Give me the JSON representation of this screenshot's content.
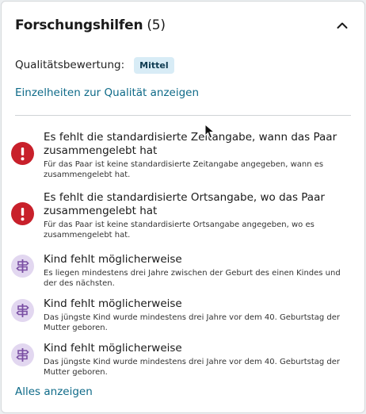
{
  "header": {
    "title": "Forschungshilfen",
    "count": "(5)"
  },
  "quality": {
    "label": "Qualitätsbewertung:",
    "badge": "Mittel",
    "details_link": "Einzelheiten zur Qualität anzeigen"
  },
  "hints": [
    {
      "icon": "error-icon",
      "title": "Es fehlt die standardisierte Zeitangabe, wann das Paar zusammengelebt hat",
      "desc": "Für das Paar ist keine standardisierte Zeitangabe angegeben, wann es zusammengelebt hat."
    },
    {
      "icon": "error-icon",
      "title": "Es fehlt die standardisierte Ortsangabe, wo das Paar zusammengelebt hat",
      "desc": "Für das Paar ist keine standardisierte Ortsangabe angegeben, wo es zusammengelebt hat."
    },
    {
      "icon": "signpost-icon",
      "title": "Kind fehlt möglicherweise",
      "desc": "Es liegen mindestens drei Jahre zwischen der Geburt des einen Kindes und der des nächsten."
    },
    {
      "icon": "signpost-icon",
      "title": "Kind fehlt möglicherweise",
      "desc": "Das jüngste Kind wurde mindestens drei Jahre vor dem 40. Geburtstag der Mutter geboren."
    },
    {
      "icon": "signpost-icon",
      "title": "Kind fehlt möglicherweise",
      "desc": "Das jüngste Kind wurde mindestens drei Jahre vor dem 40. Geburtstag der Mutter geboren."
    }
  ],
  "footer": {
    "show_all": "Alles anzeigen"
  },
  "colors": {
    "error": "#c8202b",
    "research_bg": "#e2d7f0",
    "research_fg": "#7a4fa3",
    "link": "#0e6a88",
    "badge_bg": "#d8ecf6"
  }
}
